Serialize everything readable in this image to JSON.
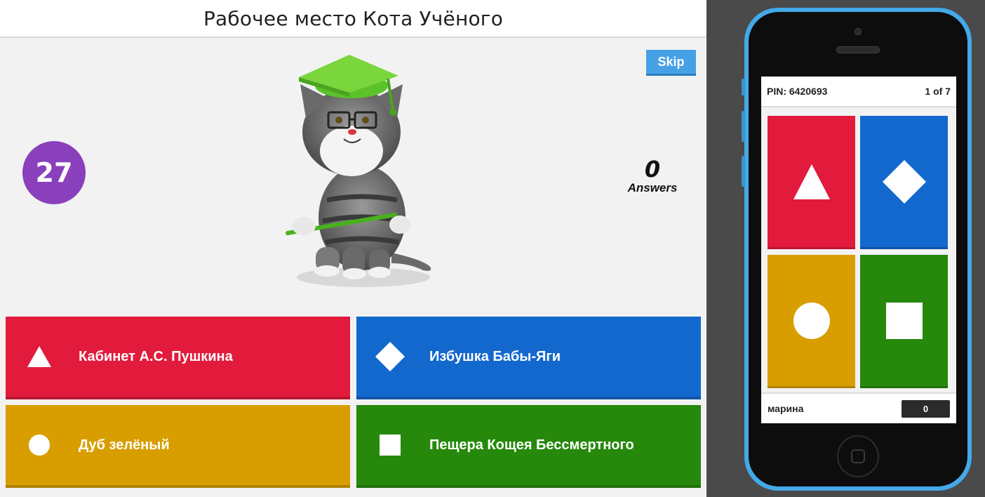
{
  "game": {
    "title": "Рабочее место Кота Учёного",
    "skip_label": "Skip",
    "timer": "27",
    "answers_count": "0",
    "answers_label": "Answers",
    "image": "cat-scholar-illustration",
    "options": [
      {
        "label": "Кабинет А.С. Пушкина",
        "shape": "triangle-icon",
        "color": "#e21b3c"
      },
      {
        "label": "Избушка Бабы-Яги",
        "shape": "diamond-icon",
        "color": "#1368ce"
      },
      {
        "label": "Дуб зелёный",
        "shape": "circle-icon",
        "color": "#d89e00"
      },
      {
        "label": "Пещера Кощея Бессмертного",
        "shape": "square-icon",
        "color": "#26890c"
      }
    ]
  },
  "phone": {
    "pin": "PIN: 6420693",
    "progress": "1 of 7",
    "player_name": "марина",
    "score": "0",
    "frame_color": "#43a9e8"
  }
}
